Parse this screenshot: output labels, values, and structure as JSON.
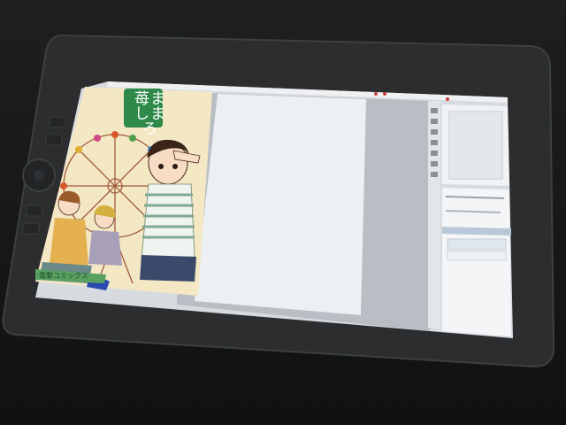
{
  "photo": {
    "subject": "",
    "cover": {
      "title_logo": "苺ましまろ",
      "publisher_band": "電撃コミックス"
    }
  },
  "colors": {
    "bezel": "#2a2c2d",
    "screen_canvas": "#e8ebee",
    "cover_background": "#f4e7c4",
    "logo_green": "#2f8a4a"
  }
}
